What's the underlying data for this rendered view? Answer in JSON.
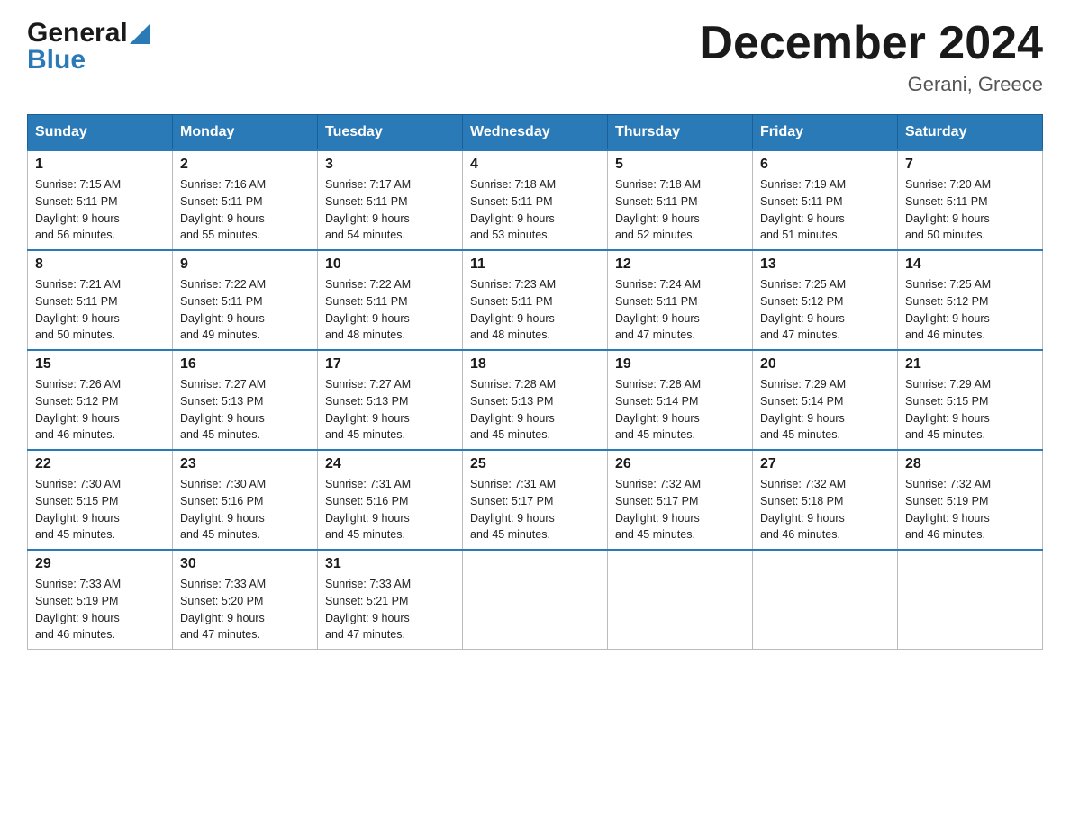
{
  "header": {
    "logo_general": "General",
    "logo_blue": "Blue",
    "main_title": "December 2024",
    "subtitle": "Gerani, Greece"
  },
  "calendar": {
    "days_of_week": [
      "Sunday",
      "Monday",
      "Tuesday",
      "Wednesday",
      "Thursday",
      "Friday",
      "Saturday"
    ],
    "weeks": [
      [
        {
          "day": "1",
          "info": "Sunrise: 7:15 AM\nSunset: 5:11 PM\nDaylight: 9 hours\nand 56 minutes."
        },
        {
          "day": "2",
          "info": "Sunrise: 7:16 AM\nSunset: 5:11 PM\nDaylight: 9 hours\nand 55 minutes."
        },
        {
          "day": "3",
          "info": "Sunrise: 7:17 AM\nSunset: 5:11 PM\nDaylight: 9 hours\nand 54 minutes."
        },
        {
          "day": "4",
          "info": "Sunrise: 7:18 AM\nSunset: 5:11 PM\nDaylight: 9 hours\nand 53 minutes."
        },
        {
          "day": "5",
          "info": "Sunrise: 7:18 AM\nSunset: 5:11 PM\nDaylight: 9 hours\nand 52 minutes."
        },
        {
          "day": "6",
          "info": "Sunrise: 7:19 AM\nSunset: 5:11 PM\nDaylight: 9 hours\nand 51 minutes."
        },
        {
          "day": "7",
          "info": "Sunrise: 7:20 AM\nSunset: 5:11 PM\nDaylight: 9 hours\nand 50 minutes."
        }
      ],
      [
        {
          "day": "8",
          "info": "Sunrise: 7:21 AM\nSunset: 5:11 PM\nDaylight: 9 hours\nand 50 minutes."
        },
        {
          "day": "9",
          "info": "Sunrise: 7:22 AM\nSunset: 5:11 PM\nDaylight: 9 hours\nand 49 minutes."
        },
        {
          "day": "10",
          "info": "Sunrise: 7:22 AM\nSunset: 5:11 PM\nDaylight: 9 hours\nand 48 minutes."
        },
        {
          "day": "11",
          "info": "Sunrise: 7:23 AM\nSunset: 5:11 PM\nDaylight: 9 hours\nand 48 minutes."
        },
        {
          "day": "12",
          "info": "Sunrise: 7:24 AM\nSunset: 5:11 PM\nDaylight: 9 hours\nand 47 minutes."
        },
        {
          "day": "13",
          "info": "Sunrise: 7:25 AM\nSunset: 5:12 PM\nDaylight: 9 hours\nand 47 minutes."
        },
        {
          "day": "14",
          "info": "Sunrise: 7:25 AM\nSunset: 5:12 PM\nDaylight: 9 hours\nand 46 minutes."
        }
      ],
      [
        {
          "day": "15",
          "info": "Sunrise: 7:26 AM\nSunset: 5:12 PM\nDaylight: 9 hours\nand 46 minutes."
        },
        {
          "day": "16",
          "info": "Sunrise: 7:27 AM\nSunset: 5:13 PM\nDaylight: 9 hours\nand 45 minutes."
        },
        {
          "day": "17",
          "info": "Sunrise: 7:27 AM\nSunset: 5:13 PM\nDaylight: 9 hours\nand 45 minutes."
        },
        {
          "day": "18",
          "info": "Sunrise: 7:28 AM\nSunset: 5:13 PM\nDaylight: 9 hours\nand 45 minutes."
        },
        {
          "day": "19",
          "info": "Sunrise: 7:28 AM\nSunset: 5:14 PM\nDaylight: 9 hours\nand 45 minutes."
        },
        {
          "day": "20",
          "info": "Sunrise: 7:29 AM\nSunset: 5:14 PM\nDaylight: 9 hours\nand 45 minutes."
        },
        {
          "day": "21",
          "info": "Sunrise: 7:29 AM\nSunset: 5:15 PM\nDaylight: 9 hours\nand 45 minutes."
        }
      ],
      [
        {
          "day": "22",
          "info": "Sunrise: 7:30 AM\nSunset: 5:15 PM\nDaylight: 9 hours\nand 45 minutes."
        },
        {
          "day": "23",
          "info": "Sunrise: 7:30 AM\nSunset: 5:16 PM\nDaylight: 9 hours\nand 45 minutes."
        },
        {
          "day": "24",
          "info": "Sunrise: 7:31 AM\nSunset: 5:16 PM\nDaylight: 9 hours\nand 45 minutes."
        },
        {
          "day": "25",
          "info": "Sunrise: 7:31 AM\nSunset: 5:17 PM\nDaylight: 9 hours\nand 45 minutes."
        },
        {
          "day": "26",
          "info": "Sunrise: 7:32 AM\nSunset: 5:17 PM\nDaylight: 9 hours\nand 45 minutes."
        },
        {
          "day": "27",
          "info": "Sunrise: 7:32 AM\nSunset: 5:18 PM\nDaylight: 9 hours\nand 46 minutes."
        },
        {
          "day": "28",
          "info": "Sunrise: 7:32 AM\nSunset: 5:19 PM\nDaylight: 9 hours\nand 46 minutes."
        }
      ],
      [
        {
          "day": "29",
          "info": "Sunrise: 7:33 AM\nSunset: 5:19 PM\nDaylight: 9 hours\nand 46 minutes."
        },
        {
          "day": "30",
          "info": "Sunrise: 7:33 AM\nSunset: 5:20 PM\nDaylight: 9 hours\nand 47 minutes."
        },
        {
          "day": "31",
          "info": "Sunrise: 7:33 AM\nSunset: 5:21 PM\nDaylight: 9 hours\nand 47 minutes."
        },
        {
          "day": "",
          "info": ""
        },
        {
          "day": "",
          "info": ""
        },
        {
          "day": "",
          "info": ""
        },
        {
          "day": "",
          "info": ""
        }
      ]
    ]
  }
}
